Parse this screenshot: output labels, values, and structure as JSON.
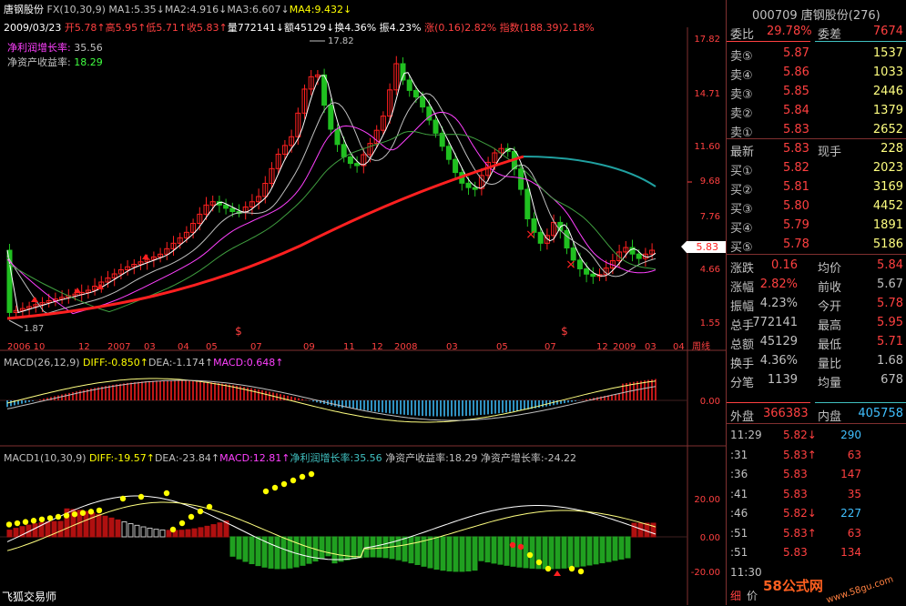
{
  "header": {
    "line1": [
      {
        "text": "唐钢股份",
        "color": "#ffffff"
      },
      {
        "text": " FX(10,30,9)",
        "color": "#c0c0c0"
      },
      {
        "text": " MA1:5.35↓",
        "color": "#c0c0c0"
      },
      {
        "text": "MA2:4.916↓",
        "color": "#c0c0c0"
      },
      {
        "text": "MA3:6.607↓",
        "color": "#c0c0c0"
      },
      {
        "text": "MA4:9.432↓",
        "color": "#ffff00"
      }
    ],
    "line2": [
      {
        "text": "2009/03/23 ",
        "color": "#ffffff"
      },
      {
        "text": "开5.78↑",
        "color": "#ff4040"
      },
      {
        "text": "高5.95↑",
        "color": "#ff4040"
      },
      {
        "text": "低5.71↑",
        "color": "#ff4040"
      },
      {
        "text": "收5.83↑",
        "color": "#ff4040"
      },
      {
        "text": "量772141↓",
        "color": "#ffffff"
      },
      {
        "text": "额45129↓",
        "color": "#ffffff"
      },
      {
        "text": "换4.36% ",
        "color": "#ffffff"
      },
      {
        "text": "振4.23% ",
        "color": "#ffffff"
      },
      {
        "text": "涨(0.16)2.82% ",
        "color": "#ff4040"
      },
      {
        "text": "指数(188.39)2.18%",
        "color": "#ff4040"
      }
    ],
    "line3": [
      {
        "text": "净利润增长率:",
        "color": "#ff40ff"
      },
      {
        "text": " 35.56",
        "color": "#c0c0c0"
      }
    ],
    "line4": [
      {
        "text": "净资产收益率:",
        "color": "#c0c0c0"
      },
      {
        "text": " 18.29",
        "color": "#40ff40"
      }
    ]
  },
  "price_axis": [
    "17.82",
    "14.71",
    "11.60",
    "9.68",
    "7.76",
    "4.66",
    "1.55"
  ],
  "high_marker": "17.82",
  "low_marker": "1.87",
  "current_price_tag": "5.83",
  "month_axis": [
    "2006 10",
    "12",
    "2007",
    "03",
    "04",
    "05",
    "07",
    "09",
    "11",
    "12",
    "2008",
    "03",
    "05",
    "07",
    "12",
    "2009",
    "03",
    "04",
    "周线"
  ],
  "macd": {
    "title": [
      {
        "text": "MACD(26,12,9) ",
        "color": "#c0c0c0"
      },
      {
        "text": "DIFF:-0.850↑",
        "color": "#ffff00"
      },
      {
        "text": "DEA:-1.174↑",
        "color": "#c0c0c0"
      },
      {
        "text": "MACD:0.648↑",
        "color": "#ff40ff"
      }
    ],
    "zero_label": "0.00"
  },
  "macd1": {
    "title": [
      {
        "text": "MACD1(10,30,9) ",
        "color": "#c0c0c0"
      },
      {
        "text": "DIFF:-19.57↑",
        "color": "#ffff00"
      },
      {
        "text": "DEA:-23.84↑",
        "color": "#c0c0c0"
      },
      {
        "text": "MACD:12.81↑",
        "color": "#ff40ff"
      },
      {
        "text": "净利润增长率:35.56 ",
        "color": "#40c0c0"
      },
      {
        "text": "净资产收益率:18.29 ",
        "color": "#c0c0c0"
      },
      {
        "text": "净资产增长率:-24.22",
        "color": "#c0c0c0"
      }
    ],
    "axis": [
      "20.00",
      "0.00",
      "-20.00"
    ]
  },
  "footer_left": "飞狐交易师",
  "right_panel": {
    "code_title": "000709 唐钢股份(276)",
    "wei_bi_label": "委比",
    "wei_bi": "29.78%",
    "wei_cha_label": "委差",
    "wei_cha": "7674",
    "sell": [
      {
        "label": "卖⑤",
        "price": "5.87",
        "vol": "1537"
      },
      {
        "label": "卖④",
        "price": "5.86",
        "vol": "1033"
      },
      {
        "label": "卖③",
        "price": "5.85",
        "vol": "2446"
      },
      {
        "label": "卖②",
        "price": "5.84",
        "vol": "1379"
      },
      {
        "label": "卖①",
        "price": "5.83",
        "vol": "2652"
      }
    ],
    "latest": {
      "label": "最新",
      "price": "5.83",
      "label2": "现手",
      "vol": "228"
    },
    "buy": [
      {
        "label": "买①",
        "price": "5.82",
        "vol": "2023"
      },
      {
        "label": "买②",
        "price": "5.81",
        "vol": "3169"
      },
      {
        "label": "买③",
        "price": "5.80",
        "vol": "4452"
      },
      {
        "label": "买④",
        "price": "5.79",
        "vol": "1891"
      },
      {
        "label": "买⑤",
        "price": "5.78",
        "vol": "5186"
      }
    ],
    "stats": [
      {
        "l1": "涨跌",
        "v1": "0.16",
        "c1": "#ff4040",
        "l2": "均价",
        "v2": "5.84",
        "c2": "#ff4040"
      },
      {
        "l1": "涨幅",
        "v1": "2.82%",
        "c1": "#ff4040",
        "l2": "前收",
        "v2": "5.67",
        "c2": "#c0c0c0"
      },
      {
        "l1": "振幅",
        "v1": "4.23%",
        "c1": "#c0c0c0",
        "l2": "今开",
        "v2": "5.78",
        "c2": "#ff4040"
      },
      {
        "l1": "总手",
        "v1": "772141",
        "c1": "#c0c0c0",
        "l2": "最高",
        "v2": "5.95",
        "c2": "#ff4040"
      },
      {
        "l1": "总额",
        "v1": "45129",
        "c1": "#c0c0c0",
        "l2": "最低",
        "v2": "5.71",
        "c2": "#ff4040"
      },
      {
        "l1": "换手",
        "v1": "4.36%",
        "c1": "#c0c0c0",
        "l2": "量比",
        "v2": "1.68",
        "c2": "#c0c0c0"
      },
      {
        "l1": "分笔",
        "v1": "1139",
        "c1": "#c0c0c0",
        "l2": "均量",
        "v2": "678",
        "c2": "#c0c0c0"
      }
    ],
    "wai_pan_label": "外盘",
    "wai_pan": "366383",
    "nei_pan_label": "内盘",
    "nei_pan": "405758",
    "ticks": [
      {
        "time": "11:29",
        "price": "5.82↓",
        "pc": "#ff4040",
        "vol": "290",
        "vc": "#40c0ff"
      },
      {
        "time": ":31",
        "price": "5.83↑",
        "pc": "#ff4040",
        "vol": "63",
        "vc": "#ff4040"
      },
      {
        "time": ":36",
        "price": "5.83",
        "pc": "#ff4040",
        "vol": "147",
        "vc": "#ff4040"
      },
      {
        "time": ":41",
        "price": "5.83",
        "pc": "#ff4040",
        "vol": "35",
        "vc": "#ff4040"
      },
      {
        "time": ":46",
        "price": "5.82↓",
        "pc": "#ff4040",
        "vol": "227",
        "vc": "#40c0ff"
      },
      {
        "time": ":51",
        "price": "5.83↑",
        "pc": "#ff4040",
        "vol": "63",
        "vc": "#ff4040"
      },
      {
        "time": ":51",
        "price": "5.83",
        "pc": "#ff4040",
        "vol": "134",
        "vc": "#ff4040"
      },
      {
        "time": "11:30",
        "price": "",
        "pc": "#ff4040",
        "vol": "",
        "vc": "#ff4040"
      }
    ],
    "bottom_tabs": [
      "细",
      "价"
    ],
    "watermark": "58公式网",
    "watermark_url": "www.58gu.com"
  }
}
